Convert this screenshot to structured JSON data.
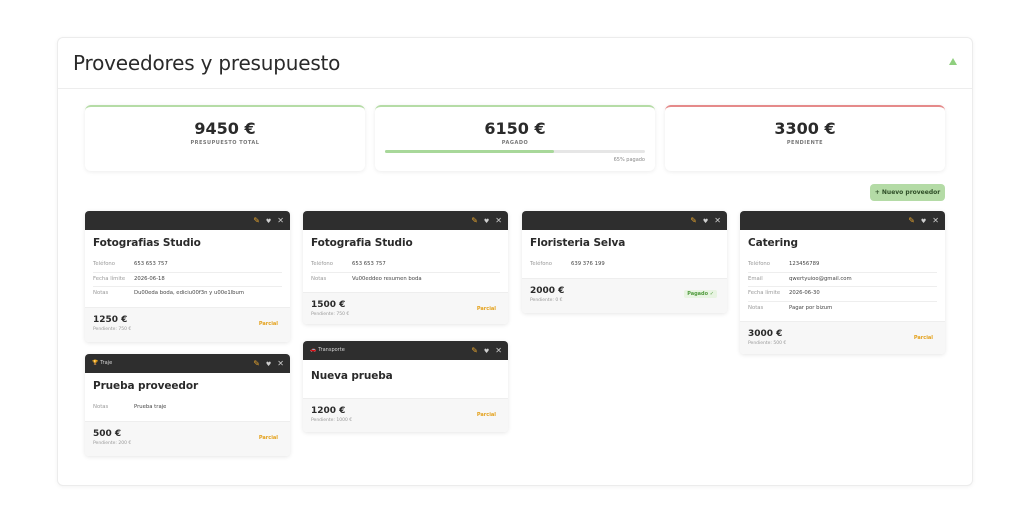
{
  "panel": {
    "title": "Proveedores y presupuesto",
    "collapse_icon": "triangle-up-icon"
  },
  "stats": {
    "total": {
      "value": "9450 €",
      "label": "PRESUPUESTO TOTAL"
    },
    "paid": {
      "value": "6150 €",
      "label": "PAGADO",
      "progress_fraction": 0.65,
      "progress_text": "65% pagado"
    },
    "pending": {
      "value": "3300 €",
      "label": "PENDIENTE"
    }
  },
  "new_button": "+ Nuevo proveedor",
  "colors": {
    "accent_green": "#b4dba6",
    "partial": "#e4a11b",
    "paid": "#4f9a3c",
    "danger": "#e58a8a"
  },
  "cards": [
    {
      "tag": "",
      "title": "Fotografias Studio",
      "fields": [
        {
          "label": "Teléfono",
          "value": "653 653 757"
        },
        {
          "label": "Fecha límite",
          "value": "2026-06-18"
        },
        {
          "label": "Notas",
          "value": "Du00eda boda, ediciu00f3n y u00e1lbum"
        }
      ],
      "amount": "1250 €",
      "pending": "Pendiente: 750 €",
      "status": "Parcial"
    },
    {
      "tag": "Traje",
      "title": "Prueba proveedor",
      "fields": [
        {
          "label": "Notas",
          "value": "Prueba traje"
        }
      ],
      "amount": "500 €",
      "pending": "Pendiente: 200 €",
      "status": "Parcial"
    },
    {
      "tag": "",
      "title": "Fotografia Studio",
      "fields": [
        {
          "label": "Teléfono",
          "value": "653 653 757"
        },
        {
          "label": "Notas",
          "value": "Vu00eddeo resumen boda"
        }
      ],
      "amount": "1500 €",
      "pending": "Pendiente: 750 €",
      "status": "Parcial"
    },
    {
      "tag": "Transporte",
      "title": "Nueva prueba",
      "fields": [],
      "amount": "1200 €",
      "pending": "Pendiente: 1000 €",
      "status": "Parcial"
    },
    {
      "tag": "",
      "title": "Floristeria Selva",
      "fields": [
        {
          "label": "Teléfono",
          "value": "639 376 199"
        }
      ],
      "amount": "2000 €",
      "pending": "Pendiente: 0 €",
      "status": "Pagado ✓"
    },
    {
      "tag": "",
      "title": "Catering",
      "fields": [
        {
          "label": "Teléfono",
          "value": "123456789"
        },
        {
          "label": "Email",
          "value": "qwertyuioo@gmail.com"
        },
        {
          "label": "Fecha límite",
          "value": "2026-06-30"
        },
        {
          "label": "Notas",
          "value": "Pagar por bizum"
        }
      ],
      "amount": "3000 €",
      "pending": "Pendiente: 500 €",
      "status": "Parcial"
    }
  ]
}
